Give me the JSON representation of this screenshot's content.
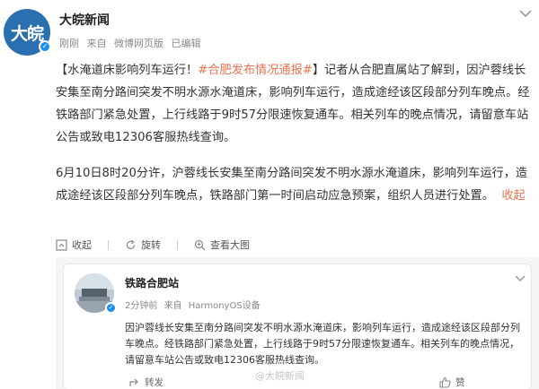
{
  "post": {
    "account_name": "大皖新闻",
    "avatar_text": "大皖",
    "meta": {
      "time": "刚刚",
      "source_prefix": "来自",
      "source": "微博网页版",
      "status": "已编辑"
    },
    "body": {
      "p1_open": "【水淹道床影响列车运行！",
      "p1_tag": "#合肥发布情况通报#",
      "p1_rest": "】记者从合肥直属站了解到，因沪蓉线长安集至南分路间突发不明水源水淹道床，影响列车运行，造成途经该区段部分列车晚点。经铁路部门紧急处置，上行线路于9时57分限速恢复通车。相关列车的晚点情况，请留意车站公告或致电12306客服热线查询。",
      "p2_text": "6月10日8时20分许，沪蓉线长安集至南分路间突发不明水源水淹道床，影响列车运行，造成途经该区段部分列车晚点，铁路部门第一时间启动应急预案，组织人员进行处置。",
      "p2_collapse": "收起"
    },
    "actions": {
      "collapse": "收起",
      "rotate": "旋转",
      "view_large": "查看大图"
    }
  },
  "repost": {
    "account_name": "铁路合肥站",
    "meta": {
      "time": "2分钟前",
      "source_prefix": "来自",
      "source": "HarmonyOS设备"
    },
    "text": "因沪蓉线长安集至南分路间突发不明水源水淹道床，影响列车运行，造成途经该区段部分列车晚点。经铁路部门紧急处置，上行线路于9时57分限速恢复通车。相关列车的晚点情况，请留意车站公告或致电12306客服热线查询。",
    "forward_label": "转发",
    "like_label": "赞",
    "watermark": "@大皖新闻"
  },
  "colors": {
    "link": "#eb7350",
    "verify": "#1e8ff0",
    "avatar_bg": "#2a6fb0"
  },
  "icons": [
    "chevron-down-icon",
    "verified-badge-icon",
    "collapse-icon",
    "rotate-icon",
    "zoom-icon",
    "forward-icon",
    "like-icon"
  ]
}
